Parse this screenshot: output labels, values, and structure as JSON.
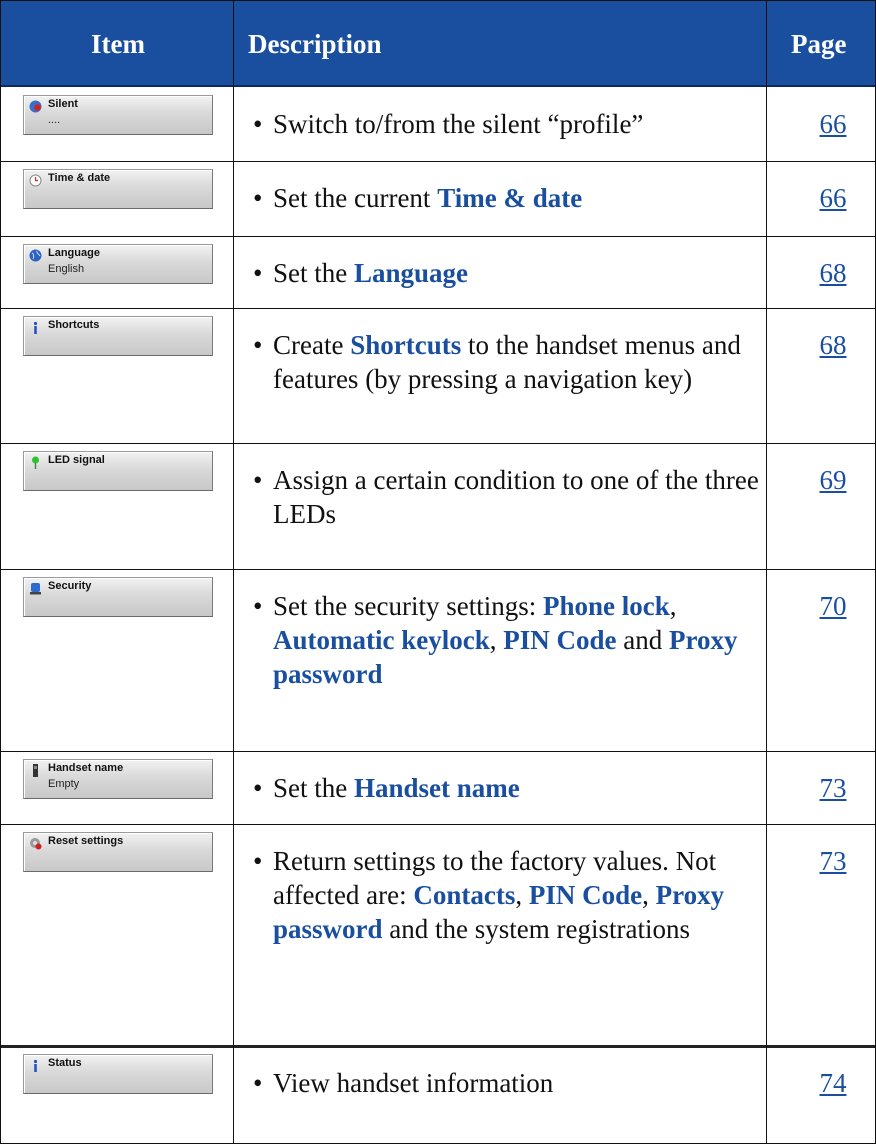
{
  "header": {
    "item": "Item",
    "description": "Description",
    "page": "Page"
  },
  "rows": [
    {
      "title": "Silent",
      "sub": "....",
      "icon": "silent-icon",
      "desc": [
        {
          "t": "Switch to/from the silent “profile”"
        }
      ],
      "page": "66"
    },
    {
      "title": "Time & date",
      "sub": "",
      "icon": "clock-icon",
      "desc": [
        {
          "t": "Set the current "
        },
        {
          "t": "Time & date",
          "kw": true
        }
      ],
      "page": "66"
    },
    {
      "title": "Language",
      "sub": "English",
      "icon": "globe-icon",
      "desc": [
        {
          "t": "Set the "
        },
        {
          "t": "Language",
          "kw": true
        }
      ],
      "page": "68"
    },
    {
      "title": "Shortcuts",
      "sub": "",
      "icon": "info-icon",
      "desc": [
        {
          "t": "Create "
        },
        {
          "t": "Shortcuts",
          "kw": true
        },
        {
          "t": " to the handset menus and features (by pressing a navigation key)"
        }
      ],
      "page": "68"
    },
    {
      "title": "LED signal",
      "sub": "",
      "icon": "led-icon",
      "desc": [
        {
          "t": "Assign a certain condition to one of the three LEDs"
        }
      ],
      "page": "69"
    },
    {
      "title": "Security",
      "sub": "",
      "icon": "shield-icon",
      "desc": [
        {
          "t": "Set the security settings: "
        },
        {
          "t": "Phone lock",
          "kw": true
        },
        {
          "t": ", "
        },
        {
          "t": "Automatic keylock",
          "kw": true
        },
        {
          "t": ", "
        },
        {
          "t": "PIN Code",
          "kw": true
        },
        {
          "t": " and "
        },
        {
          "t": "Proxy password",
          "kw": true
        }
      ],
      "page": "70"
    },
    {
      "title": "Handset name",
      "sub": "Empty",
      "icon": "handset-icon",
      "desc": [
        {
          "t": "Set the "
        },
        {
          "t": "Handset name",
          "kw": true
        }
      ],
      "page": "73"
    },
    {
      "title": "Reset settings",
      "sub": "",
      "icon": "reset-icon",
      "desc": [
        {
          "t": "Return settings to the factory values. Not affected are: "
        },
        {
          "t": "Contacts",
          "kw": true
        },
        {
          "t": ", "
        },
        {
          "t": "PIN Code",
          "kw": true
        },
        {
          "t": ", "
        },
        {
          "t": "Proxy password",
          "kw": true
        },
        {
          "t": " and the system registrations"
        }
      ],
      "page": "73"
    },
    {
      "title": "Status",
      "sub": "",
      "icon": "info-icon",
      "desc": [
        {
          "t": "View handset information"
        }
      ],
      "page": "74"
    }
  ],
  "colors": {
    "header_bg": "#1a4fa0",
    "keyword": "#1a4fa0",
    "link": "#1a4fa0"
  }
}
